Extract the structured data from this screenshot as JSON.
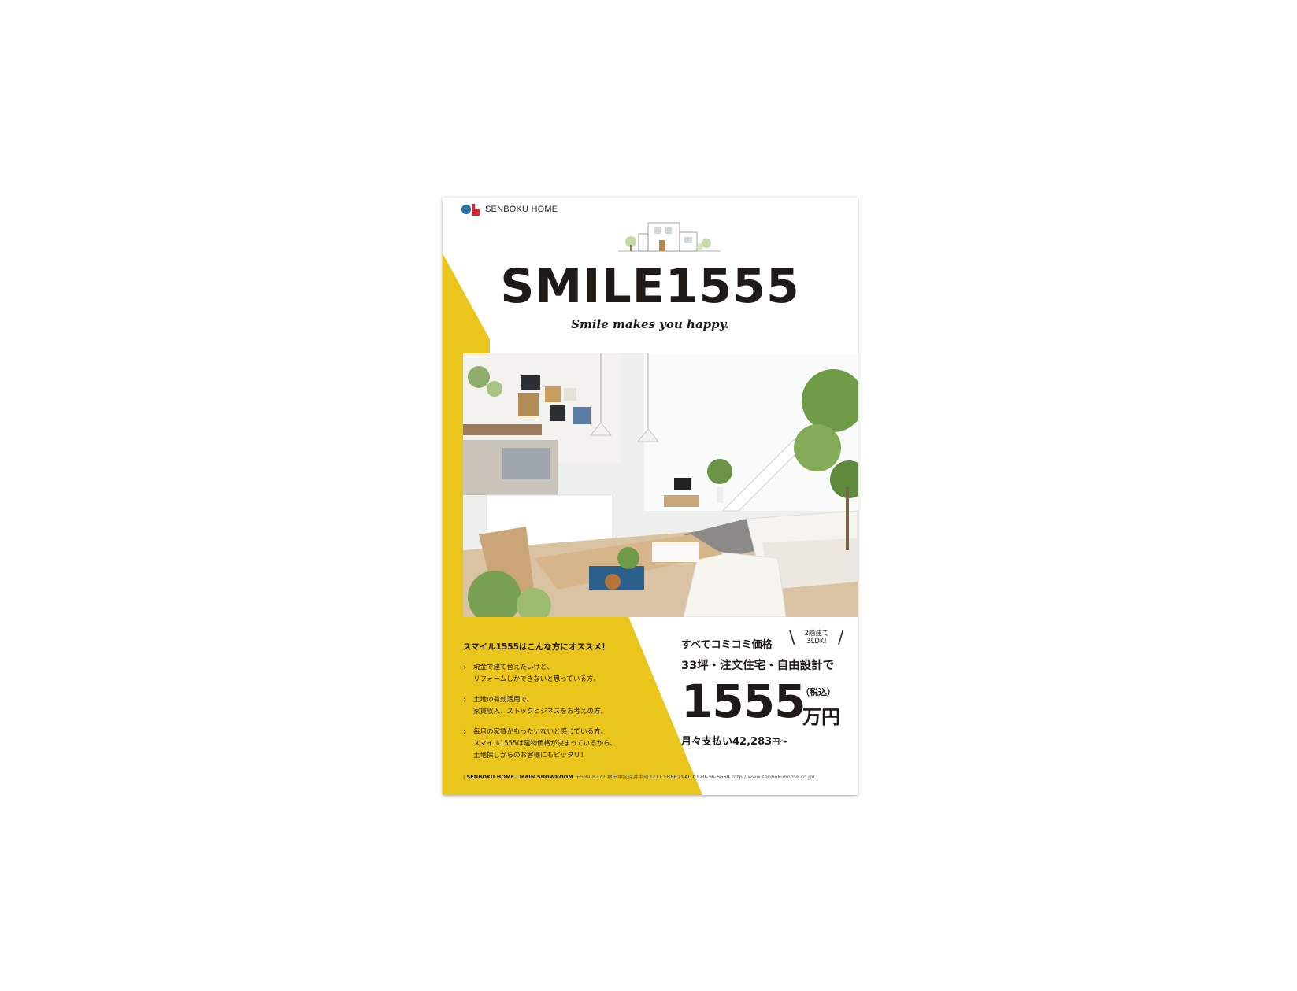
{
  "brand": {
    "name": "SENBOKU HOME",
    "accent_yellow": "#eac51c",
    "text_color": "#1f1a17"
  },
  "header": {
    "title": "SMILE1555",
    "tagline": "Smile makes you happy."
  },
  "recommend": {
    "heading": "スマイル1555はこんな方にオススメ！",
    "items": [
      {
        "line1": "現金で建て替えたいけど、",
        "line2": "リフォームしかできないと思っている方。",
        "line3": ""
      },
      {
        "line1": "土地の有効活用で、",
        "line2": "家賃収入、ストックビジネスをお考えの方。",
        "line3": ""
      },
      {
        "line1": "毎月の家賃がもったいないと感じている方。",
        "line2": "スマイル1555は建物価格が決まっているから、",
        "line3": "土地探しからのお客様にもピッタリ！"
      }
    ]
  },
  "price": {
    "lead": "すべてコミコミ価格",
    "badge_line1": "2階建て",
    "badge_line2": "3LDK!",
    "sub": "33坪・注文住宅・自由設計で",
    "amount": "1555",
    "tax": "（税込）",
    "unit": "万円",
    "monthly": "月々支払い42,283",
    "monthly_suffix": "円〜"
  },
  "footer": {
    "company": "SENBOKU HOME",
    "showroom_label": "MAIN SHOWROOM",
    "postal": "〒599-8272",
    "address": "堺市中区深井中町3211",
    "free_dial_label": "FREE DIAL",
    "phone": "0120-36-6668",
    "url": "http://www.senbokuhome.co.jp/"
  }
}
